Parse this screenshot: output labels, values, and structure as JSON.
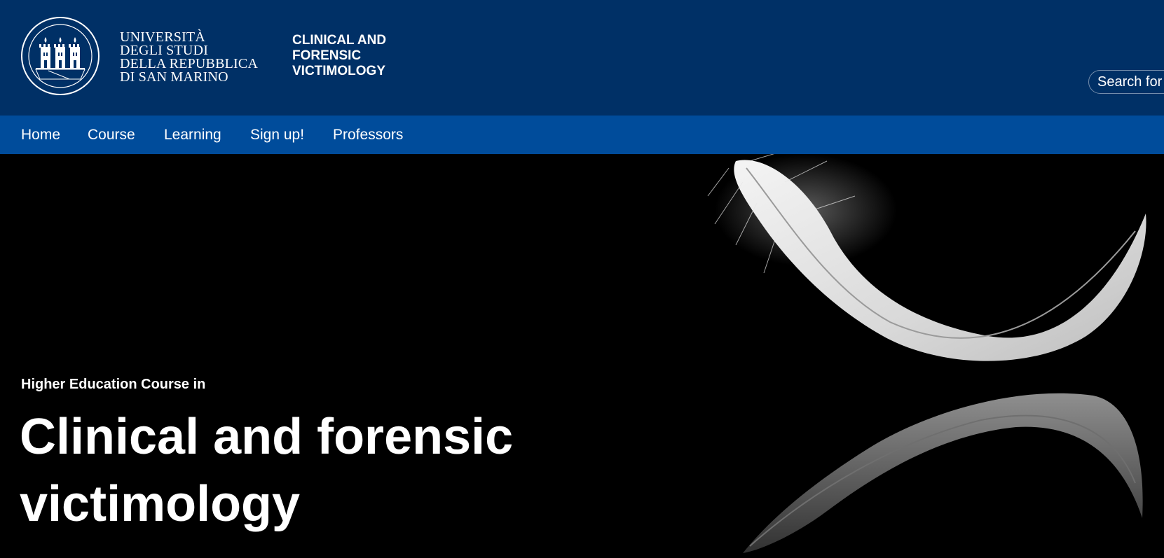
{
  "header": {
    "university_lines": [
      "UNIVERSITÀ",
      "DEGLI STUDI",
      "DELLA REPUBBLICA",
      "DI SAN MARINO"
    ],
    "course_lines": [
      "CLINICAL AND",
      "FORENSIC",
      "VICTIMOLOGY"
    ],
    "logo_icon": "university-seal-icon",
    "search_label": "Search for"
  },
  "nav": {
    "items": [
      {
        "label": "Home"
      },
      {
        "label": "Course"
      },
      {
        "label": "Learning"
      },
      {
        "label": "Sign up!"
      },
      {
        "label": "Professors"
      }
    ]
  },
  "hero": {
    "kicker": "Higher Education Course in",
    "title": "Clinical and forensic victimology",
    "image": "feather-reflection-image"
  },
  "colors": {
    "header_bg": "#003066",
    "nav_bg": "#004c9b",
    "hero_bg": "#000000",
    "text": "#ffffff"
  }
}
